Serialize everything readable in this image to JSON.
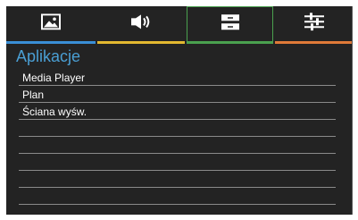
{
  "tabs": [
    {
      "icon": "picture-icon",
      "underline_color": "#3a8fd6"
    },
    {
      "icon": "speaker-icon",
      "underline_color": "#e3b830"
    },
    {
      "icon": "apps-icon",
      "underline_color": "#4aa14f",
      "selected": true
    },
    {
      "icon": "settings-sliders-icon",
      "underline_color": "#e07a38"
    }
  ],
  "section": {
    "title": "Aplikacje"
  },
  "menu": {
    "items": [
      "Media Player",
      "Plan",
      "Ściana wyśw."
    ]
  },
  "colors": {
    "background": "#232323",
    "title": "#4a9fd4",
    "text": "#ffffff",
    "divider": "#8a8a8a"
  }
}
